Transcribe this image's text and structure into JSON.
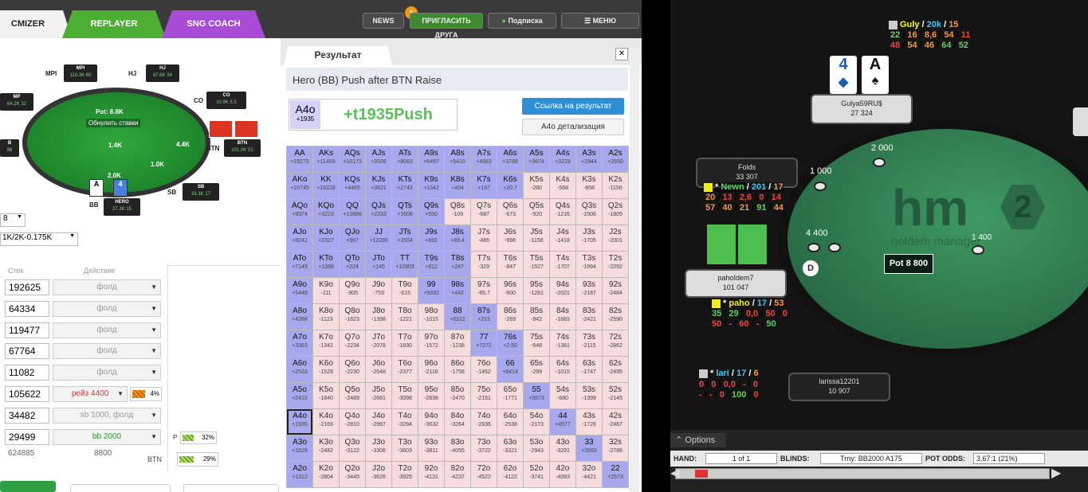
{
  "left": {
    "tabs": [
      "CMIZER",
      "REPLAYER",
      "SNG COACH"
    ],
    "news": "NEWS",
    "notif": "1",
    "invite": "ПРИГЛАСИТЬ ДРУГА",
    "subscribe": "Подписка",
    "menu": "МЕНЮ",
    "table": {
      "pot": "Pot: 8.8K",
      "reset": "Обнулить ставки",
      "bets": [
        "1.4K",
        "4.4K",
        "2.0K",
        "1.0K"
      ],
      "seats": [
        {
          "n": "MPI",
          "s": "119.3K",
          "b": "60"
        },
        {
          "n": "HJ",
          "s": "67.6K",
          "b": "34"
        },
        {
          "n": "CO",
          "s": "10.9K",
          "b": "5.5"
        },
        {
          "n": "BTN",
          "s": "101.0K",
          "b": "51"
        },
        {
          "n": "SB",
          "s": "33.3K",
          "b": "17"
        },
        {
          "n": "HERO",
          "s": "27.3K",
          "b": "15"
        },
        {
          "n": "MP",
          "s": "64.2K",
          "b": "32"
        },
        {
          "n": "B",
          "s": "",
          "b": "96"
        }
      ],
      "side_labels": [
        "MPI",
        "HJ",
        "CO",
        "BTN",
        "SB",
        "BB"
      ]
    },
    "sel1": "8",
    "sel2": "1K/2K-0.175K",
    "head_stack": "Стек",
    "head_action": "Действие",
    "rows": [
      {
        "s": "192625",
        "a": "фолд"
      },
      {
        "s": "64334",
        "a": "фолд"
      },
      {
        "s": "119477",
        "a": "фолд"
      },
      {
        "s": "67764",
        "a": "фолд"
      },
      {
        "s": "11082",
        "a": "фолд"
      },
      {
        "s": "105622",
        "a": "рейз 4400",
        "p": "4%"
      },
      {
        "s": "34482",
        "a": "sb 1000, фолд"
      },
      {
        "s": "29499",
        "a": "bb 2000"
      }
    ],
    "foot": {
      "x": "624885",
      "y": "8800",
      "btn": "BTN",
      "p1": "32%",
      "p2": "29%",
      "pl": "P"
    },
    "result": {
      "tab": "Результат",
      "close": "✕",
      "title": "Hero (BB) Push after BTN Raise",
      "hand": "A4o",
      "hand_ev": "+1935",
      "push": "+t1935Push",
      "link_btn": "Ссылка на результат",
      "detail_btn": "A4o детализация"
    }
  },
  "grid": [
    [
      "AA",
      "+19270",
      1
    ],
    [
      "AKs",
      "+11469",
      1
    ],
    [
      "AQs",
      "+10173",
      1
    ],
    [
      "AJs",
      "+9106",
      1
    ],
    [
      "ATs",
      "+8083",
      1
    ],
    [
      "A9s",
      "+6497",
      1
    ],
    [
      "A8s",
      "+5410",
      1
    ],
    [
      "A7s",
      "+4563",
      1
    ],
    [
      "A6s",
      "+3788",
      1
    ],
    [
      "A5s",
      "+3674",
      1
    ],
    [
      "A4s",
      "+3229",
      1
    ],
    [
      "A3s",
      "+2944",
      1
    ],
    [
      "A2s",
      "+2650",
      1
    ],
    [
      "AKo",
      "+10745",
      1
    ],
    [
      "KK",
      "+16228",
      1
    ],
    [
      "KQs",
      "+4465",
      1
    ],
    [
      "KJs",
      "+3621",
      1
    ],
    [
      "KTs",
      "+2743",
      1
    ],
    [
      "K9s",
      "+1342",
      1
    ],
    [
      "K8s",
      "+404",
      1
    ],
    [
      "K7s",
      "+197",
      1
    ],
    [
      "K6s",
      "+20.7",
      1
    ],
    [
      "K5s",
      "-280",
      0
    ],
    [
      "K4s",
      "-568",
      0
    ],
    [
      "K3s",
      "-858",
      0
    ],
    [
      "K2s",
      "-1156",
      0
    ],
    [
      "AQo",
      "+9374",
      1
    ],
    [
      "KQo",
      "+3223",
      1
    ],
    [
      "QQ",
      "+13886",
      1
    ],
    [
      "QJs",
      "+2333",
      1
    ],
    [
      "QTs",
      "+1606",
      1
    ],
    [
      "Q9s",
      "+550",
      1
    ],
    [
      "Q8s",
      "-109",
      0
    ],
    [
      "Q7s",
      "-687",
      0
    ],
    [
      "Q6s",
      "-673",
      0
    ],
    [
      "Q5s",
      "-920",
      0
    ],
    [
      "Q4s",
      "-1216",
      0
    ],
    [
      "Q3s",
      "-1506",
      0
    ],
    [
      "Q2s",
      "-1805",
      0
    ],
    [
      "AJo",
      "+8242",
      1
    ],
    [
      "KJo",
      "+2327",
      1
    ],
    [
      "QJo",
      "+997",
      1
    ],
    [
      "JJ",
      "+12286",
      1
    ],
    [
      "JTs",
      "+1504",
      1
    ],
    [
      "J9s",
      "+692",
      1
    ],
    [
      "J8s",
      "+89.4",
      1
    ],
    [
      "J7s",
      "-485",
      0
    ],
    [
      "J6s",
      "-996",
      0
    ],
    [
      "J5s",
      "-1156",
      0
    ],
    [
      "J4s",
      "-1418",
      0
    ],
    [
      "J3s",
      "-1705",
      0
    ],
    [
      "J2s",
      "-2001",
      0
    ],
    [
      "ATo",
      "+7149",
      1
    ],
    [
      "KTo",
      "+1388",
      1
    ],
    [
      "QTo",
      "+224",
      1
    ],
    [
      "JTo",
      "+145",
      1
    ],
    [
      "TT",
      "+10903",
      1
    ],
    [
      "T9s",
      "+812",
      1
    ],
    [
      "T8s",
      "+247",
      1
    ],
    [
      "T7s",
      "-329",
      0
    ],
    [
      "T6s",
      "-847",
      0
    ],
    [
      "T5s",
      "-1527",
      0
    ],
    [
      "T4s",
      "-1707",
      0
    ],
    [
      "T3s",
      "-1994",
      0
    ],
    [
      "T2s",
      "-2292",
      0
    ],
    [
      "A9o",
      "+5448",
      1
    ],
    [
      "K9o",
      "-111",
      0
    ],
    [
      "Q9o",
      "-905",
      0
    ],
    [
      "J9o",
      "-753",
      0
    ],
    [
      "T9o",
      "-615",
      0
    ],
    [
      "99",
      "+9332",
      1
    ],
    [
      "98s",
      "+442",
      1
    ],
    [
      "97s",
      "-85.7",
      0
    ],
    [
      "96s",
      "-600",
      0
    ],
    [
      "95s",
      "-1281",
      0
    ],
    [
      "94s",
      "-2021",
      0
    ],
    [
      "93s",
      "-2187",
      0
    ],
    [
      "92s",
      "-2484",
      0
    ],
    [
      "A8o",
      "+4268",
      1
    ],
    [
      "K8o",
      "-1123",
      0
    ],
    [
      "Q8o",
      "-1623",
      0
    ],
    [
      "J8o",
      "-1398",
      0
    ],
    [
      "T8o",
      "-1221",
      0
    ],
    [
      "98o",
      "-1015",
      0
    ],
    [
      "88",
      "+8212",
      1
    ],
    [
      "87s",
      "+223",
      1
    ],
    [
      "86s",
      "-269",
      0
    ],
    [
      "85s",
      "-942",
      0
    ],
    [
      "84s",
      "-1683",
      0
    ],
    [
      "83s",
      "-2421",
      0
    ],
    [
      "82s",
      "-2590",
      0
    ],
    [
      "A7o",
      "+3363",
      1
    ],
    [
      "K7o",
      "-1342",
      0
    ],
    [
      "Q7o",
      "-2234",
      0
    ],
    [
      "J7o",
      "-2078",
      0
    ],
    [
      "T7o",
      "-1830",
      0
    ],
    [
      "97o",
      "-1572",
      0
    ],
    [
      "87o",
      "-1238",
      0
    ],
    [
      "77",
      "+7272",
      1
    ],
    [
      "76s",
      "+2.50",
      1
    ],
    [
      "75s",
      "-648",
      0
    ],
    [
      "74s",
      "-1381",
      0
    ],
    [
      "73s",
      "-2115",
      0
    ],
    [
      "72s",
      "-2862",
      0
    ],
    [
      "A6o",
      "+2533",
      1
    ],
    [
      "K6o",
      "-1529",
      0
    ],
    [
      "Q6o",
      "-2230",
      0
    ],
    [
      "J6o",
      "-2548",
      0
    ],
    [
      "T6o",
      "-2377",
      0
    ],
    [
      "96o",
      "-2116",
      0
    ],
    [
      "86o",
      "-1758",
      0
    ],
    [
      "76o",
      "-1462",
      0
    ],
    [
      "66",
      "+6414",
      1
    ],
    [
      "65s",
      "-299",
      0
    ],
    [
      "64s",
      "-1015",
      0
    ],
    [
      "63s",
      "-1747",
      0
    ],
    [
      "62s",
      "-2495",
      0
    ],
    [
      "A5o",
      "+2415",
      1
    ],
    [
      "K5o",
      "-1840",
      0
    ],
    [
      "Q5o",
      "-2489",
      0
    ],
    [
      "J5o",
      "-2681",
      0
    ],
    [
      "T5o",
      "-3098",
      0
    ],
    [
      "95o",
      "-2838",
      0
    ],
    [
      "85o",
      "-2470",
      0
    ],
    [
      "75o",
      "-2151",
      0
    ],
    [
      "65o",
      "-1771",
      0
    ],
    [
      "55",
      "+5573",
      1
    ],
    [
      "54s",
      "-680",
      0
    ],
    [
      "53s",
      "-1399",
      0
    ],
    [
      "52s",
      "-2145",
      0
    ],
    [
      "A4o",
      "+1935",
      2
    ],
    [
      "K4o",
      "-2169",
      0
    ],
    [
      "Q4o",
      "-2810",
      0
    ],
    [
      "J4o",
      "-2997",
      0
    ],
    [
      "T4o",
      "-3294",
      0
    ],
    [
      "94o",
      "-3632",
      0
    ],
    [
      "84o",
      "-3264",
      0
    ],
    [
      "74o",
      "-2936",
      0
    ],
    [
      "64o",
      "-2538",
      0
    ],
    [
      "54o",
      "-2173",
      0
    ],
    [
      "44",
      "+4577",
      1
    ],
    [
      "43s",
      "-1726",
      0
    ],
    [
      "42s",
      "-2467",
      0
    ],
    [
      "A3o",
      "+1629",
      1
    ],
    [
      "K3o",
      "-2482",
      0
    ],
    [
      "Q3o",
      "-3122",
      0
    ],
    [
      "J3o",
      "-3306",
      0
    ],
    [
      "T3o",
      "-3603",
      0
    ],
    [
      "93o",
      "-3811",
      0
    ],
    [
      "83o",
      "-4055",
      0
    ],
    [
      "73o",
      "-3722",
      0
    ],
    [
      "63o",
      "-3321",
      0
    ],
    [
      "53o",
      "-2943",
      0
    ],
    [
      "43o",
      "-3291",
      0
    ],
    [
      "33",
      "+3563",
      1
    ],
    [
      "32s",
      "-2786",
      0
    ],
    [
      "A2o",
      "+1312",
      1
    ],
    [
      "K2o",
      "-2804",
      0
    ],
    [
      "Q2o",
      "-3445",
      0
    ],
    [
      "J2o",
      "-3626",
      0
    ],
    [
      "T2o",
      "-3925",
      0
    ],
    [
      "92o",
      "-4131",
      0
    ],
    [
      "82o",
      "-4237",
      0
    ],
    [
      "72o",
      "-4522",
      0
    ],
    [
      "62o",
      "-4122",
      0
    ],
    [
      "52o",
      "-3741",
      0
    ],
    [
      "42o",
      "-4083",
      0
    ],
    [
      "32o",
      "-4421",
      0
    ],
    [
      "22",
      "+2573",
      1
    ]
  ],
  "right": {
    "guly": {
      "name": "Guly",
      "n1": "20k",
      "n2": "15",
      "l2": [
        "22",
        "16",
        "8,6",
        "54",
        "11"
      ],
      "l3": [
        "48",
        "54",
        "46",
        "64",
        "52"
      ],
      "plate": "Gulya59RU$",
      "stack": "27 324"
    },
    "cards": [
      "4",
      "A"
    ],
    "folds": {
      "label": "Folds",
      "stack": "33 307"
    },
    "newn": {
      "name": "Newn",
      "n1": "201",
      "n2": "17",
      "l2": [
        "20",
        "13",
        "2,6",
        "0",
        "14"
      ],
      "l3": [
        "57",
        "40",
        "21",
        "91",
        "44"
      ]
    },
    "paho": {
      "name": "paho",
      "n1": "17",
      "n2": "53",
      "l2": [
        "35",
        "29",
        "0,0",
        "50",
        "0"
      ],
      "l3": [
        "50",
        "-",
        "60",
        "-",
        "50"
      ],
      "plate": "pahoIdem7",
      "stack": "101 047"
    },
    "lari": {
      "name": "lari",
      "n1": "17",
      "n2": "6",
      "l2": [
        "0",
        "0",
        "0,0",
        "-",
        "0"
      ],
      "l3": [
        "-",
        "-",
        "0",
        "100",
        "0"
      ],
      "plate": "larissa12201",
      "stack": "10 907"
    },
    "bets": [
      "2 000",
      "1 000",
      "4 400",
      "1 400"
    ],
    "pot": "Pot 8 800",
    "logo": "hm",
    "logo2": "holdem manager",
    "dealer": "D",
    "chip_labels": [
      "1K",
      "1K",
      "1K"
    ],
    "options": "Options",
    "status": {
      "hand_l": "HAND:",
      "hand": "1 of 1",
      "blinds_l": "BLINDS:",
      "blinds": "Trny: BB2000 A175",
      "pot_l": "POT ODDS:",
      "pot": "3,67:1 (21%)"
    }
  }
}
